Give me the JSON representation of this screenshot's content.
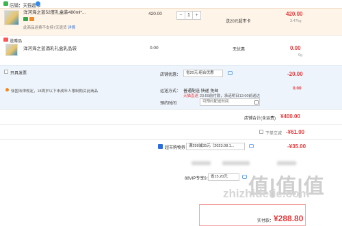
{
  "store": {
    "label": "店铺：天猫超市"
  },
  "item1": {
    "name": "洋河海之蓝52度礼盒装480ml*...",
    "note_text": "此商品运费不支持7天退货",
    "note_link": "详情",
    "unit_price": "420.00",
    "qty": "1",
    "minus": "−",
    "plus": "+",
    "promo": "送20元超市卡",
    "total": "420.00",
    "weight": "3.47kg"
  },
  "gift": {
    "section_label": "送赠品",
    "name": "洋河海之蓝酒乳礼盒乳品袋",
    "price": "0.00",
    "tag": "无优惠",
    "total": "0.00",
    "weight": "0g"
  },
  "invoice": {
    "open_label": "开具发票",
    "address_text": "徐国法律规定，18周岁以下未成年人限制购买此商品",
    "coupon_label": "店铺优惠：",
    "coupon_value": "省20元:组合优惠",
    "coupon_amount": "-20.00",
    "shipping_label": "运送方式：",
    "shipping_value": "普通配送 快递 免邮",
    "express_tag": "天猫直送",
    "express_text": "23:59前付款，承诺明日12:00前送达",
    "shipping_amount": "0.00",
    "time_label": "预约时间",
    "time_placeholder": "可预约配送时间"
  },
  "subtotal": {
    "label": "店铺合计(含运费)",
    "amount": "¥400.00"
  },
  "discount1": {
    "label": "下单立减",
    "amount": "-¥61.00"
  },
  "discount2": {
    "label": "超市购物券",
    "value": "满299减35元（2023.08.1...",
    "amount": "-¥35.00"
  },
  "vip": {
    "label": "88VIP专享9.5折",
    "value": "省15.20元"
  },
  "total": {
    "label": "实付款：",
    "amount": "¥288.80"
  },
  "watermark": {
    "big": "值|值|值",
    "small": "zhizhidetie.com"
  },
  "colors": {
    "accent_red": "#e4393c",
    "link_blue": "#2d6cdf",
    "store_green": "#3cb54a",
    "orange": "#f08a24"
  }
}
